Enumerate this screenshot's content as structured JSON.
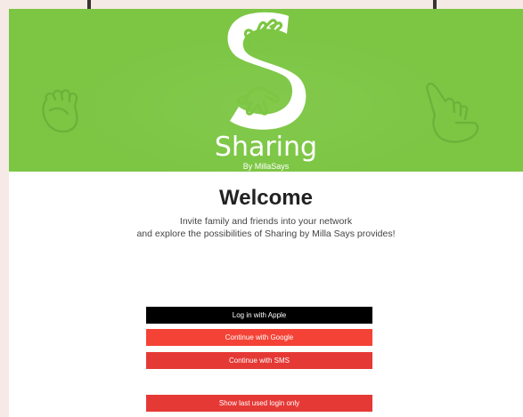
{
  "brand": {
    "title": "Sharing",
    "subtitle": "By MillaSays",
    "logo_icon": "sharing-s-hands-logo",
    "hero_color": "#7cc643"
  },
  "welcome": {
    "title": "Welcome",
    "line1": "Invite family and friends into your network",
    "line2": "and explore the possibilities of Sharing by Milla Says provides!"
  },
  "buttons": {
    "apple": "Log in with Apple",
    "google": "Continue with Google",
    "sms": "Continue with SMS",
    "last_login": "Show last used login only"
  },
  "colors": {
    "apple": "#000000",
    "google": "#f44336",
    "sms": "#e53935"
  }
}
